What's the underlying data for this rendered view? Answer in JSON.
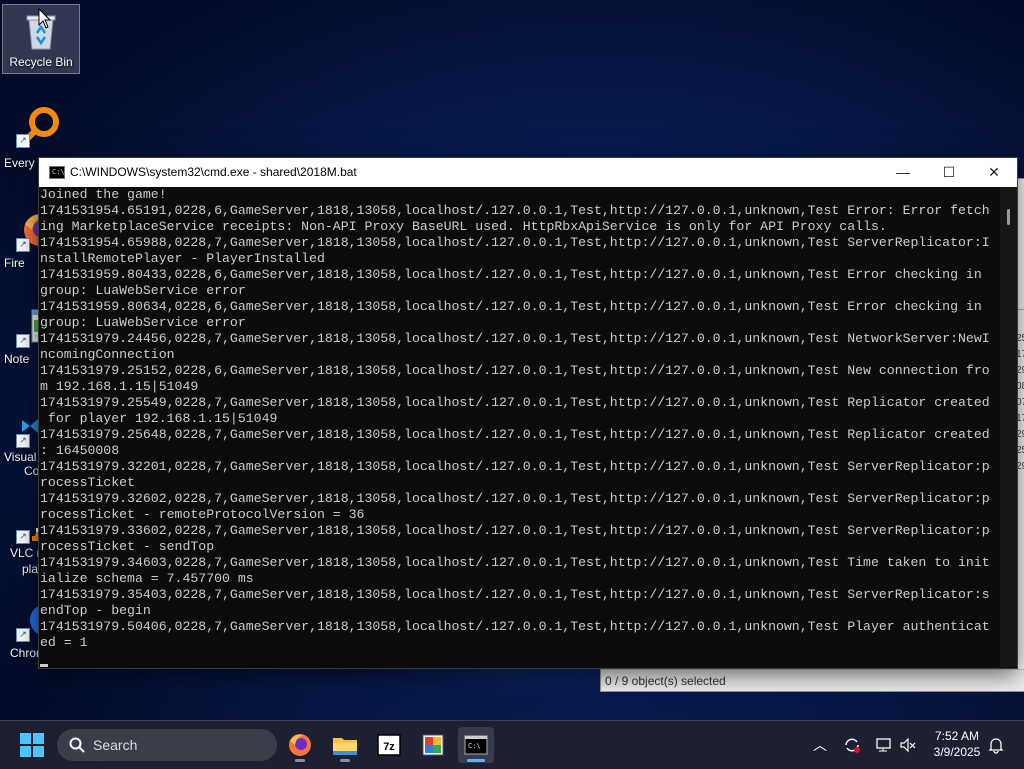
{
  "desktop": {
    "icons": [
      {
        "label": "Recycle Bin",
        "icon": "recycle-bin-icon"
      },
      {
        "label": "Every",
        "icon": "everything-search-icon"
      },
      {
        "label": "Fire",
        "icon": "firefox-icon"
      },
      {
        "label": "Note",
        "icon": "notepad-icon"
      },
      {
        "label": "Visual",
        "label2": "Co",
        "icon": "vscode-icon"
      },
      {
        "label": "VLC m",
        "label2": "pla",
        "icon": "vlc-icon"
      },
      {
        "label": "Chrom",
        "icon": "chrome-icon"
      }
    ]
  },
  "explorer": {
    "status": "0 / 9 object(s) selected",
    "column_values": [
      "25",
      "17",
      "29",
      "08",
      "07",
      "17",
      "29",
      "25",
      "29"
    ]
  },
  "console": {
    "title": "C:\\WINDOWS\\system32\\cmd.exe - shared\\2018M.bat",
    "lines": [
      "Joined the game!",
      "1741531954.65191,0228,6,GameServer,1818,13058,localhost/.127.0.0.1,Test,http://127.0.0.1,unknown,Test Error: Error fetch",
      "ing MarketplaceService receipts: Non-API Proxy BaseURL used. HttpRbxApiService is only for API Proxy calls.",
      "1741531954.65988,0228,7,GameServer,1818,13058,localhost/.127.0.0.1,Test,http://127.0.0.1,unknown,Test ServerReplicator:I",
      "nstallRemotePlayer - PlayerInstalled",
      "1741531959.80433,0228,6,GameServer,1818,13058,localhost/.127.0.0.1,Test,http://127.0.0.1,unknown,Test Error checking in",
      "group: LuaWebService error",
      "1741531959.80634,0228,6,GameServer,1818,13058,localhost/.127.0.0.1,Test,http://127.0.0.1,unknown,Test Error checking in",
      "group: LuaWebService error",
      "1741531979.24456,0228,7,GameServer,1818,13058,localhost/.127.0.0.1,Test,http://127.0.0.1,unknown,Test NetworkServer:NewI",
      "ncomingConnection",
      "1741531979.25152,0228,6,GameServer,1818,13058,localhost/.127.0.0.1,Test,http://127.0.0.1,unknown,Test New connection fro",
      "m 192.168.1.15|51049",
      "1741531979.25549,0228,7,GameServer,1818,13058,localhost/.127.0.0.1,Test,http://127.0.0.1,unknown,Test Replicator created",
      " for player 192.168.1.15|51049",
      "1741531979.25648,0228,7,GameServer,1818,13058,localhost/.127.0.0.1,Test,http://127.0.0.1,unknown,Test Replicator created",
      ": 16450008",
      "1741531979.32201,0228,7,GameServer,1818,13058,localhost/.127.0.0.1,Test,http://127.0.0.1,unknown,Test ServerReplicator:p",
      "rocessTicket",
      "1741531979.32602,0228,7,GameServer,1818,13058,localhost/.127.0.0.1,Test,http://127.0.0.1,unknown,Test ServerReplicator:p",
      "rocessTicket - remoteProtocolVersion = 36",
      "1741531979.33602,0228,7,GameServer,1818,13058,localhost/.127.0.0.1,Test,http://127.0.0.1,unknown,Test ServerReplicator:p",
      "rocessTicket - sendTop",
      "1741531979.34603,0228,7,GameServer,1818,13058,localhost/.127.0.0.1,Test,http://127.0.0.1,unknown,Test Time taken to init",
      "ialize schema = 7.457700 ms",
      "1741531979.35403,0228,7,GameServer,1818,13058,localhost/.127.0.0.1,Test,http://127.0.0.1,unknown,Test ServerReplicator:s",
      "endTop - begin",
      "1741531979.50406,0228,7,GameServer,1818,13058,localhost/.127.0.0.1,Test,http://127.0.0.1,unknown,Test Player authenticat",
      "ed = 1"
    ]
  },
  "taskbar": {
    "search_label": "Search",
    "apps": [
      "firefox-icon",
      "file-explorer-icon",
      "7zip-icon",
      "paint-icon",
      "cmd-icon"
    ],
    "time": "7:52 AM",
    "date": "3/9/2025"
  }
}
